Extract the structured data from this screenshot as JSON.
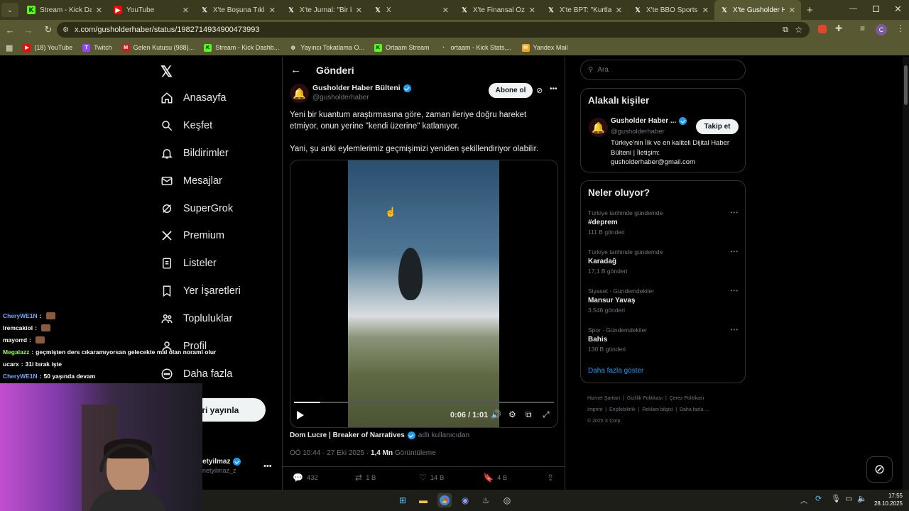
{
  "browser": {
    "tabs": [
      {
        "title": "Stream - Kick Dashbo",
        "icon": "kick-icon",
        "active": false
      },
      {
        "title": "YouTube",
        "icon": "youtube-icon",
        "active": false
      },
      {
        "title": "X'te Boşuna Tıklama:",
        "icon": "x-icon",
        "active": false
      },
      {
        "title": "X'te Jurnal: \"Bir kadın",
        "icon": "x-icon",
        "active": false
      },
      {
        "title": "X",
        "icon": "x-icon",
        "active": false
      },
      {
        "title": "X'te Finansal Özgürlü",
        "icon": "x-icon",
        "active": false
      },
      {
        "title": "X'te BPT: \"Kurtlar Vad",
        "icon": "x-icon",
        "active": false
      },
      {
        "title": "X'te BBO Sports: \"Can",
        "icon": "x-icon",
        "active": false
      },
      {
        "title": "X'te Gusholder Habe",
        "icon": "x-icon",
        "active": true
      }
    ],
    "url": "x.com/gusholderhaber/status/1982714934900473993",
    "profile_letter": "C",
    "bookmarks": [
      {
        "label": "(18) YouTube",
        "icon": "youtube-icon"
      },
      {
        "label": "Twitch",
        "icon": "twitch-icon"
      },
      {
        "label": "Gelen Kutusu (988)...",
        "icon": "mail-icon"
      },
      {
        "label": "Stream - Kick Dashb...",
        "icon": "kick-icon"
      },
      {
        "label": "Yayıncı Tokatlama O...",
        "icon": "globe-icon"
      },
      {
        "label": "Ortaam Stream",
        "icon": "kick-icon"
      },
      {
        "label": "ortaam - Kick Stats,...",
        "icon": "stats-icon"
      },
      {
        "label": "Yandex Mail",
        "icon": "yandex-mail-icon"
      }
    ]
  },
  "nav": {
    "items": [
      {
        "label": "Anasayfa",
        "icon": "home-icon"
      },
      {
        "label": "Keşfet",
        "icon": "search-icon"
      },
      {
        "label": "Bildirimler",
        "icon": "bell-icon"
      },
      {
        "label": "Mesajlar",
        "icon": "mail-icon"
      },
      {
        "label": "SuperGrok",
        "icon": "grok-icon"
      },
      {
        "label": "Premium",
        "icon": "x-icon"
      },
      {
        "label": "Listeler",
        "icon": "list-icon"
      },
      {
        "label": "Yer İşaretleri",
        "icon": "bookmark-icon"
      },
      {
        "label": "Topluluklar",
        "icon": "communities-icon"
      },
      {
        "label": "Profil",
        "icon": "profile-icon"
      },
      {
        "label": "Daha fazla",
        "icon": "more-icon"
      }
    ],
    "post_button": "eri yayınla",
    "account_name": "etyilmaz",
    "account_handle": "netyilmaz_z"
  },
  "post": {
    "header": "Gönderi",
    "author_name": "Gusholder Haber Bülteni",
    "author_handle": "@gusholderhaber",
    "subscribe": "Abone ol",
    "text1": "Yeni bir kuantum araştırmasına göre, zaman ileriye doğru hareket etmiyor, onun yerine \"kendi üzerine\" katlanıyor.",
    "text2": "Yani, şu anki eylemlerimiz geçmişimizi yeniden şekillendiriyor olabilir.",
    "video_time": "0:06 / 1:01",
    "video_progress": 0.1,
    "attribution_name": "Dom Lucre | Breaker of Narratives",
    "attribution_suffix": "adlı kullanıcıdan",
    "timestamp": "ÖÖ 10:44 · 27 Eki 2025 · ",
    "views": "1,4 Mn",
    "views_label": "Görüntüleme",
    "replies": "432",
    "reposts": "1 B",
    "likes": "14 B",
    "bookmarks": "4 B"
  },
  "sidebar": {
    "search_placeholder": "Ara",
    "related_title": "Alakalı kişiler",
    "related_name": "Gusholder Haber ...",
    "related_handle": "@gusholderhaber",
    "related_bio": "Türkiye'nin İlk ve en kaliteli Dijital Haber Bülteni | İletişim: gusholderhaber@gmail.com",
    "follow": "Takip et",
    "trends_title": "Neler oluyor?",
    "trends": [
      {
        "context": "Türkiye tarihinde gündemde",
        "title": "#deprem",
        "count": "111 B gönderi"
      },
      {
        "context": "Türkiye tarihinde gündemde",
        "title": "Karadağ",
        "count": "17,1 B gönderi"
      },
      {
        "context": "Siyaset · Gündemdekiler",
        "title": "Mansur Yavaş",
        "count": "3.546 gönderi"
      },
      {
        "context": "Spor · Gündemdekiler",
        "title": "Bahis",
        "count": "130 B gönderi"
      }
    ],
    "show_more": "Daha fazla göster",
    "footer_links": [
      "Hizmet Şartları",
      "Gizlilik Politikası",
      "Çerez Politikası",
      "Imprint",
      "Erişilebilirlik",
      "Reklam bilgisi",
      "Daha fazla ..."
    ],
    "copyright": "© 2025 X Corp."
  },
  "chat": [
    {
      "user": "CheryWE1N",
      "message": "",
      "color": "#6fa8ff"
    },
    {
      "user": "lremcakiol",
      "message": "",
      "color": "#ffffff"
    },
    {
      "user": "mayorrd",
      "message": "",
      "color": "#ffffff"
    },
    {
      "user": "Megalazz",
      "message": "geçmişten ders cıkaramıyorsan gelecekte mal olan noraml olur",
      "color": "#9cff5a"
    },
    {
      "user": "ucarx",
      "message": "31i bırak işte",
      "color": "#ffffff"
    },
    {
      "user": "CheryWE1N",
      "message": "50 yaşında devam",
      "color": "#6fa8ff"
    }
  ],
  "taskbar": {
    "time": "17:55",
    "date": "28.10.2025"
  }
}
